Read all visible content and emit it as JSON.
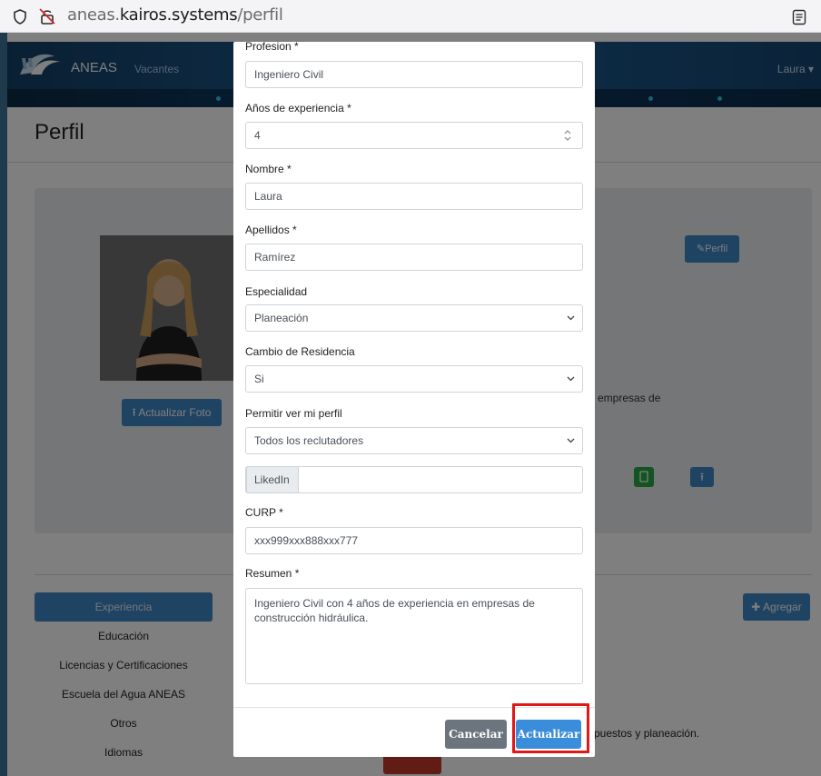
{
  "browser": {
    "url_prefix": "aneas.",
    "url_domain": "kairos.systems",
    "url_path": "/perfil"
  },
  "nav": {
    "brand": "ANEAS",
    "vacantes": "Vacantes",
    "user": "Laura"
  },
  "page": {
    "title": "Perfil",
    "btn_actualizar_foto": "Actualizar Foto",
    "btn_perfil": "Perfil",
    "card_text_fragment": "empresas de",
    "side_nav": [
      "Experiencia",
      "Educación",
      "Licencias y Certificaciones",
      "Escuela del Agua ANEAS",
      "Otros",
      "Idiomas"
    ],
    "btn_agregar": "Agregar",
    "bg_text_fragment": "puestos y planeación."
  },
  "modal": {
    "profesion_label": "Profesion *",
    "profesion_value": "Ingeniero Civil",
    "anios_label": "Años de experiencia *",
    "anios_value": "4",
    "nombre_label": "Nombre *",
    "nombre_value": "Laura",
    "apellidos_label": "Apellidos *",
    "apellidos_value": "Ramírez",
    "especialidad_label": "Especialidad",
    "especialidad_value": "Planeación",
    "cambio_label": "Cambio de Residencia",
    "cambio_value": "Si",
    "permitir_label": "Permitir ver mi perfil",
    "permitir_value": "Todos los reclutadores",
    "linkedin_addon": "LikedIn",
    "linkedin_value": "",
    "curp_label": "CURP *",
    "curp_value": "xxx999xxx888xxx777",
    "resumen_label": "Resumen *",
    "resumen_value": "Ingeniero Civil con 4 años de experiencia en empresas de construcción hidráulica.",
    "btn_cancelar": "Cancelar",
    "btn_actualizar": "Actualizar"
  },
  "colors": {
    "primary": "#3f86c7",
    "highlight": "#e01818",
    "cancel": "#6c757d"
  }
}
